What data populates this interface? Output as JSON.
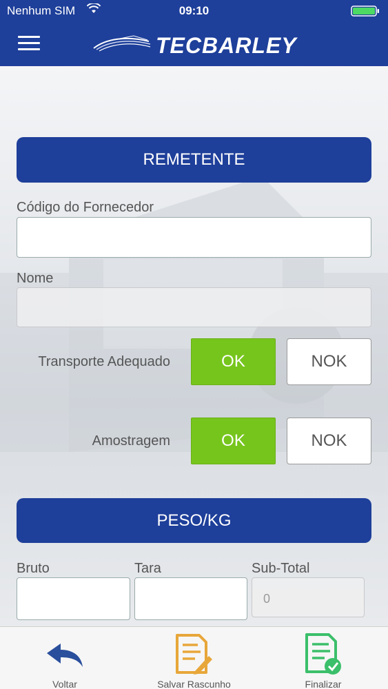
{
  "status_bar": {
    "carrier": "Nenhum SIM",
    "time": "09:10"
  },
  "header": {
    "logo_text": "TECBARLEY",
    "brand_color": "#1e3f9a"
  },
  "remetente": {
    "title": "REMETENTE",
    "codigo_label": "Código do Fornecedor",
    "codigo_value": "",
    "nome_label": "Nome",
    "nome_value": "",
    "transporte_label": "Transporte Adequado",
    "amostragem_label": "Amostragem",
    "ok_label": "OK",
    "nok_label": "NOK",
    "ok_color": "#76c51d"
  },
  "peso": {
    "title": "PESO/KG",
    "bruto_label": "Bruto",
    "tara_label": "Tara",
    "subtotal_label": "Sub-Total",
    "subtotal_value": "0"
  },
  "tabbar": {
    "voltar": "Voltar",
    "salvar": "Salvar Rascunho",
    "finalizar": "Finalizar",
    "icons": [
      "back-arrow-icon",
      "draft-document-icon",
      "finalize-document-icon"
    ]
  }
}
